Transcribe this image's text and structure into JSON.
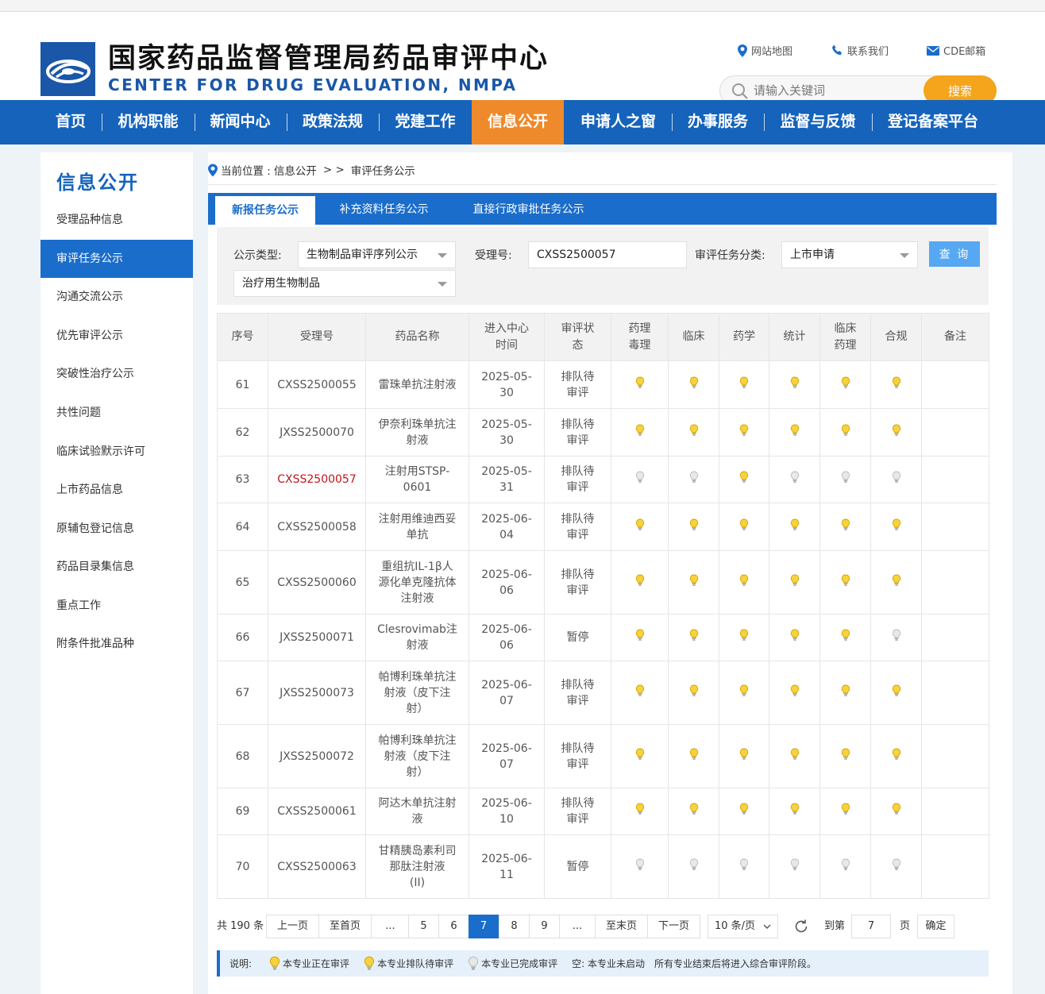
{
  "header": {
    "title_cn": "国家药品监督管理局药品审评中心",
    "title_en": "CENTER FOR DRUG EVALUATION, NMPA",
    "links": {
      "sitemap": "网站地图",
      "contact": "联系我们",
      "mail": "CDE邮箱"
    },
    "search": {
      "placeholder": "请输入关键词",
      "button": "搜索"
    }
  },
  "nav": {
    "items": [
      "首页",
      "机构职能",
      "新闻中心",
      "政策法规",
      "党建工作",
      "信息公开",
      "申请人之窗",
      "办事服务",
      "监督与反馈",
      "登记备案平台"
    ],
    "active": "信息公开"
  },
  "sidebar": {
    "title": "信息公开",
    "items": [
      "受理品种信息",
      "审评任务公示",
      "沟通交流公示",
      "优先审评公示",
      "突破性治疗公示",
      "共性问题",
      "临床试验默示许可",
      "上市药品信息",
      "原辅包登记信息",
      "药品目录集信息",
      "重点工作",
      "附条件批准品种"
    ],
    "active": "审评任务公示"
  },
  "breadcrumb": {
    "prefix": "当前位置 : ",
    "section": "信息公开",
    "sep": "> >",
    "page": "审评任务公示"
  },
  "tabs": [
    "新报任务公示",
    "补充资料任务公示",
    "直接行政审批任务公示"
  ],
  "filters": {
    "type_label": "公示类型:",
    "type_value": "生物制品审评序列公示",
    "accept_label": "受理号:",
    "accept_value": "CXSS2500057",
    "category_label": "审评任务分类:",
    "category_value": "上市申请",
    "subtype_value": "治疗用生物制品",
    "query_button": "查 询"
  },
  "table": {
    "headers": {
      "seq": "序号",
      "accept_no": "受理号",
      "drug_name": "药品名称",
      "entry_time_1": "进入中心",
      "entry_time_2": "时间",
      "status_1": "审评状",
      "status_2": "态",
      "pharmtox_1": "药理",
      "pharmtox_2": "毒理",
      "clinical": "临床",
      "pharmacy": "药学",
      "stats": "统计",
      "clinpharm_1": "临床",
      "clinpharm_2": "药理",
      "compliance": "合规",
      "remark": "备注"
    },
    "rows": [
      {
        "seq": "61",
        "accept_no": "CXSS2500055",
        "name": [
          "雷珠单抗注射液"
        ],
        "date": [
          "2025-05-",
          "30"
        ],
        "status": [
          "排队待",
          "审评"
        ],
        "bulbs": [
          "yellow",
          "yellow",
          "yellow",
          "yellow",
          "yellow",
          "yellow"
        ],
        "remark": "",
        "highlight": false
      },
      {
        "seq": "62",
        "accept_no": "JXSS2500070",
        "name": [
          "伊奈利珠单抗注",
          "射液"
        ],
        "date": [
          "2025-05-",
          "30"
        ],
        "status": [
          "排队待",
          "审评"
        ],
        "bulbs": [
          "yellow",
          "yellow",
          "yellow",
          "yellow",
          "yellow",
          "yellow"
        ],
        "remark": "",
        "highlight": false
      },
      {
        "seq": "63",
        "accept_no": "CXSS2500057",
        "name": [
          "注射用STSP-",
          "0601"
        ],
        "date": [
          "2025-05-",
          "31"
        ],
        "status": [
          "排队待",
          "审评"
        ],
        "bulbs": [
          "white",
          "white",
          "yellow",
          "white",
          "white",
          "white"
        ],
        "remark": "",
        "highlight": true
      },
      {
        "seq": "64",
        "accept_no": "CXSS2500058",
        "name": [
          "注射用维迪西妥",
          "单抗"
        ],
        "date": [
          "2025-06-",
          "04"
        ],
        "status": [
          "排队待",
          "审评"
        ],
        "bulbs": [
          "yellow",
          "yellow",
          "yellow",
          "yellow",
          "yellow",
          "yellow"
        ],
        "remark": "",
        "highlight": false
      },
      {
        "seq": "65",
        "accept_no": "CXSS2500060",
        "name": [
          "重组抗IL-1β人",
          "源化单克隆抗体",
          "注射液"
        ],
        "date": [
          "2025-06-",
          "06"
        ],
        "status": [
          "排队待",
          "审评"
        ],
        "bulbs": [
          "yellow",
          "yellow",
          "yellow",
          "yellow",
          "yellow",
          "yellow"
        ],
        "remark": "",
        "highlight": false
      },
      {
        "seq": "66",
        "accept_no": "JXSS2500071",
        "name": [
          "Clesrovimab注",
          "射液"
        ],
        "date": [
          "2025-06-",
          "06"
        ],
        "status": [
          "暂停"
        ],
        "bulbs": [
          "yellow",
          "yellow",
          "yellow",
          "yellow",
          "yellow",
          "white"
        ],
        "remark": "",
        "highlight": false
      },
      {
        "seq": "67",
        "accept_no": "JXSS2500073",
        "name": [
          "帕博利珠单抗注",
          "射液（皮下注",
          "射）"
        ],
        "date": [
          "2025-06-",
          "07"
        ],
        "status": [
          "排队待",
          "审评"
        ],
        "bulbs": [
          "yellow",
          "yellow",
          "yellow",
          "yellow",
          "yellow",
          "yellow"
        ],
        "remark": "",
        "highlight": false
      },
      {
        "seq": "68",
        "accept_no": "JXSS2500072",
        "name": [
          "帕博利珠单抗注",
          "射液（皮下注",
          "射）"
        ],
        "date": [
          "2025-06-",
          "07"
        ],
        "status": [
          "排队待",
          "审评"
        ],
        "bulbs": [
          "yellow",
          "yellow",
          "yellow",
          "yellow",
          "yellow",
          "yellow"
        ],
        "remark": "",
        "highlight": false
      },
      {
        "seq": "69",
        "accept_no": "CXSS2500061",
        "name": [
          "阿达木单抗注射",
          "液"
        ],
        "date": [
          "2025-06-",
          "10"
        ],
        "status": [
          "排队待",
          "审评"
        ],
        "bulbs": [
          "yellow",
          "yellow",
          "yellow",
          "yellow",
          "yellow",
          "yellow"
        ],
        "remark": "",
        "highlight": false
      },
      {
        "seq": "70",
        "accept_no": "CXSS2500063",
        "name": [
          "甘精胰岛素利司",
          "那肽注射液",
          "(II)"
        ],
        "date": [
          "2025-06-",
          "11"
        ],
        "status": [
          "暂停"
        ],
        "bulbs": [
          "white",
          "white",
          "white",
          "white",
          "white",
          "white"
        ],
        "remark": "",
        "highlight": false
      }
    ]
  },
  "pager": {
    "total": "共 190 条",
    "prev": "上一页",
    "first": "至首页",
    "ellipsis": "...",
    "pages": [
      "5",
      "6",
      "7",
      "8",
      "9"
    ],
    "current": "7",
    "last": "至末页",
    "next": "下一页",
    "page_size": "10 条/页",
    "goto_label": "到第",
    "goto_value": "7",
    "goto_suffix": "页",
    "confirm": "确定"
  },
  "legend": {
    "label": "说明:",
    "in_review": "本专业正在审评",
    "queued": "本专业排队待审评",
    "done": "本专业已完成审评",
    "empty": "空: 本专业未启动",
    "note": "所有专业结束后将进入综合审评阶段。"
  },
  "colors": {
    "brand_blue": "#1563bb",
    "nav_active": "#ee8a2b",
    "search_button": "#f4a51c",
    "highlight_text": "#c0161c",
    "bulb_yellow": "#f5d33f",
    "bulb_white": "#e8e8e8"
  }
}
